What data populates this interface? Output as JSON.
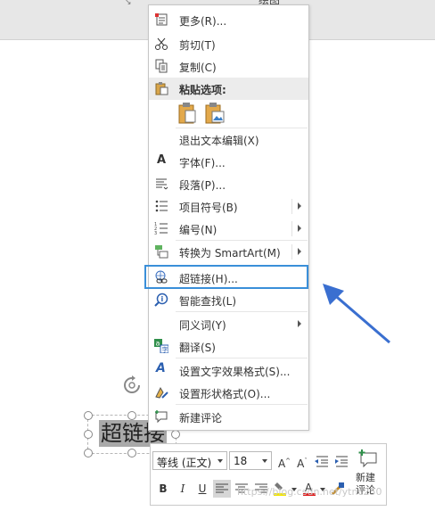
{
  "ribbon": {
    "tab_label": "绘图"
  },
  "context_menu": {
    "items": [
      {
        "label": "更多(R)..."
      },
      {
        "label": "剪切(T)"
      },
      {
        "label": "复制(C)"
      },
      {
        "label": "粘贴选项:"
      },
      {
        "label": "退出文本编辑(X)"
      },
      {
        "label": "字体(F)..."
      },
      {
        "label": "段落(P)..."
      },
      {
        "label": "项目符号(B)"
      },
      {
        "label": "编号(N)"
      },
      {
        "label": "转换为 SmartArt(M)"
      },
      {
        "label": "超链接(H)..."
      },
      {
        "label": "智能查找(L)"
      },
      {
        "label": "同义词(Y)"
      },
      {
        "label": "翻译(S)"
      },
      {
        "label": "设置文字效果格式(S)..."
      },
      {
        "label": "设置形状格式(O)..."
      },
      {
        "label": "新建评论"
      }
    ]
  },
  "textbox": {
    "text": "超链接"
  },
  "mini_toolbar": {
    "font_name": "等线 (正文)",
    "font_size": "18",
    "new_comment_label": "新建\n评论",
    "bold": "B",
    "italic": "I",
    "underline": "U"
  },
  "watermark": "https://blog.csdn.net/ytnc250",
  "colors": {
    "highlight_border": "#3a8fd9",
    "arrow": "#3a6fd0",
    "font_color_bar": "#e01e1e",
    "highlight_color_bar": "#f2e600"
  }
}
